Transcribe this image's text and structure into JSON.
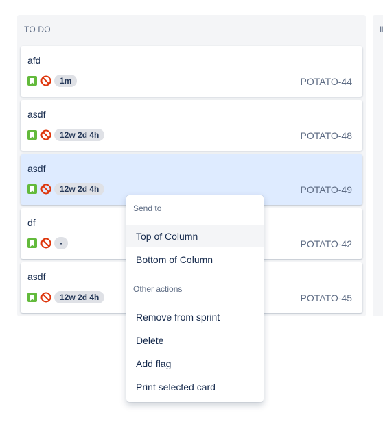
{
  "column": {
    "title": "TO DO",
    "next_title": "IN"
  },
  "cards": [
    {
      "summary": "afd",
      "estimate": "1m",
      "key": "POTATO-44",
      "selected": false
    },
    {
      "summary": "asdf",
      "estimate": "12w 2d 4h",
      "key": "POTATO-48",
      "selected": false
    },
    {
      "summary": "asdf",
      "estimate": "12w 2d 4h",
      "key": "POTATO-49",
      "selected": true
    },
    {
      "summary": "df",
      "estimate": "-",
      "key": "POTATO-42",
      "selected": false
    },
    {
      "summary": "asdf",
      "estimate": "12w 2d 4h",
      "key": "POTATO-45",
      "selected": false
    }
  ],
  "icons": {
    "issue_type": "story-icon",
    "priority": "blocker-icon"
  },
  "colors": {
    "story_green": "#63ba3c",
    "blocker_red": "#de350b",
    "selected_card": "#deebff",
    "column_bg": "#f4f5f7"
  },
  "menu": {
    "send_to_heading": "Send to",
    "top_of_column": "Top of Column",
    "bottom_of_column": "Bottom of Column",
    "other_actions_heading": "Other actions",
    "remove_from_sprint": "Remove from sprint",
    "delete": "Delete",
    "add_flag": "Add flag",
    "print_selected_card": "Print selected card"
  }
}
